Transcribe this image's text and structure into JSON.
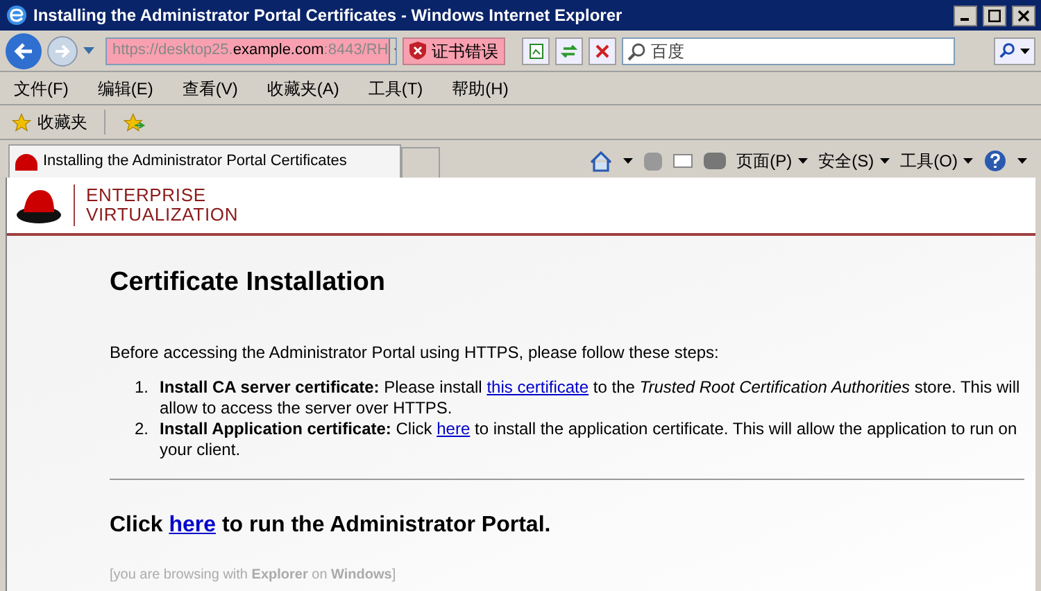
{
  "window": {
    "title": "Installing the Administrator Portal Certificates - Windows Internet Explorer"
  },
  "address": {
    "prefix": "https://",
    "domain_before": "desktop25.",
    "domain": "example.com",
    "suffix": ":8443/RH",
    "cert_error": "证书错误"
  },
  "search": {
    "placeholder": "百度"
  },
  "menu": [
    "文件(F)",
    "编辑(E)",
    "查看(V)",
    "收藏夹(A)",
    "工具(T)",
    "帮助(H)"
  ],
  "favorites": {
    "label": "收藏夹"
  },
  "tab": {
    "title": "Installing the Administrator Portal Certificates"
  },
  "command_bar": [
    "页面(P)",
    "安全(S)",
    "工具(O)"
  ],
  "brand": [
    "ENTERPRISE",
    "VIRTUALIZATION"
  ],
  "heading": "Certificate Installation",
  "intro": "Before accessing the Administrator Portal using HTTPS, please follow these steps:",
  "steps": [
    {
      "number": "1.",
      "label": "Install CA server certificate:",
      "before": "Please install",
      "link": "this certificate",
      "after": "to the *Trusted Root Certification Authorities* store. This will allow to access the server over HTTPS."
    },
    {
      "number": "2.",
      "label": "Install Application certificate:",
      "before": "Click",
      "link": "here",
      "after": "to install the application certificate. This will allow the application to run on your client."
    }
  ],
  "run": {
    "before": "Click",
    "link": "here",
    "after": "to run the Administrator Portal."
  },
  "footer": "[you are browsing with **Explorer** on **Windows**]"
}
